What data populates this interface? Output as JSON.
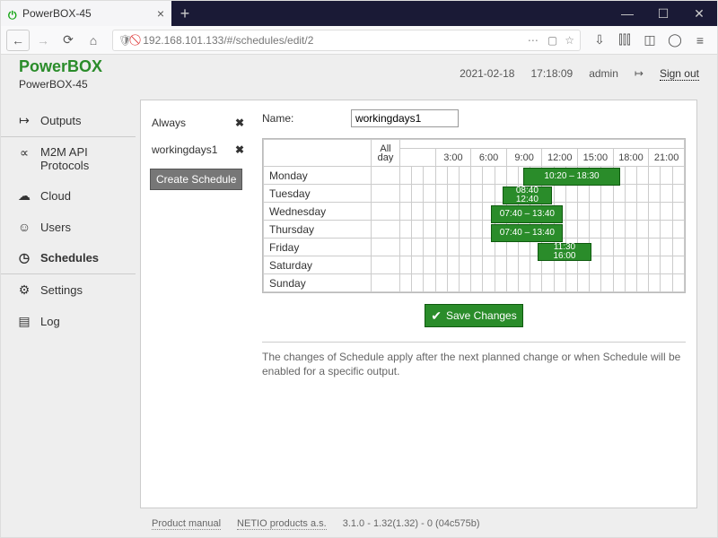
{
  "browser": {
    "tab_title": "PowerBOX-45",
    "url": "192.168.101.133/#/schedules/edit/2"
  },
  "header": {
    "brand": "PowerBOX",
    "device": "PowerBOX-45",
    "date": "2021-02-18",
    "time": "17:18:09",
    "user": "admin",
    "signout": "Sign out"
  },
  "nav": {
    "items": [
      {
        "icon": "↦",
        "label": "Outputs"
      },
      {
        "icon": "∝",
        "label": "M2M API Protocols"
      },
      {
        "icon": "☁",
        "label": "Cloud"
      },
      {
        "icon": "☺",
        "label": "Users"
      },
      {
        "icon": "◷",
        "label": "Schedules"
      },
      {
        "icon": "⚙",
        "label": "Settings"
      },
      {
        "icon": "▤",
        "label": "Log"
      }
    ],
    "active": 4
  },
  "schedules": {
    "list": [
      "Always",
      "workingdays1"
    ],
    "create_label": "Create Schedule"
  },
  "editor": {
    "name_label": "Name:",
    "name_value": "workingdays1",
    "allday_label": "All day",
    "hours": [
      "3:00",
      "6:00",
      "9:00",
      "12:00",
      "15:00",
      "18:00",
      "21:00"
    ],
    "days": [
      "Monday",
      "Tuesday",
      "Wednesday",
      "Thursday",
      "Friday",
      "Saturday",
      "Sunday"
    ],
    "slots": [
      {
        "day": "Monday",
        "label": "10:20 – 18:30",
        "start_pct": 43,
        "width_pct": 34
      },
      {
        "day": "Tuesday",
        "label": "08:40\n12:40",
        "start_pct": 36,
        "width_pct": 17
      },
      {
        "day": "Wednesday",
        "label": "07:40 – 13:40",
        "start_pct": 32,
        "width_pct": 25
      },
      {
        "day": "Thursday",
        "label": "07:40 – 13:40",
        "start_pct": 32,
        "width_pct": 25
      },
      {
        "day": "Friday",
        "label": "11:30\n16:00",
        "start_pct": 48,
        "width_pct": 19
      }
    ],
    "save_label": "Save Changes",
    "note": "The changes of Schedule apply after the next planned change or when Schedule will be enabled for a specific output."
  },
  "footer": {
    "manual": "Product manual",
    "vendor": "NETIO products a.s.",
    "version": "3.1.0 - 1.32(1.32) - 0 (04c575b)"
  }
}
